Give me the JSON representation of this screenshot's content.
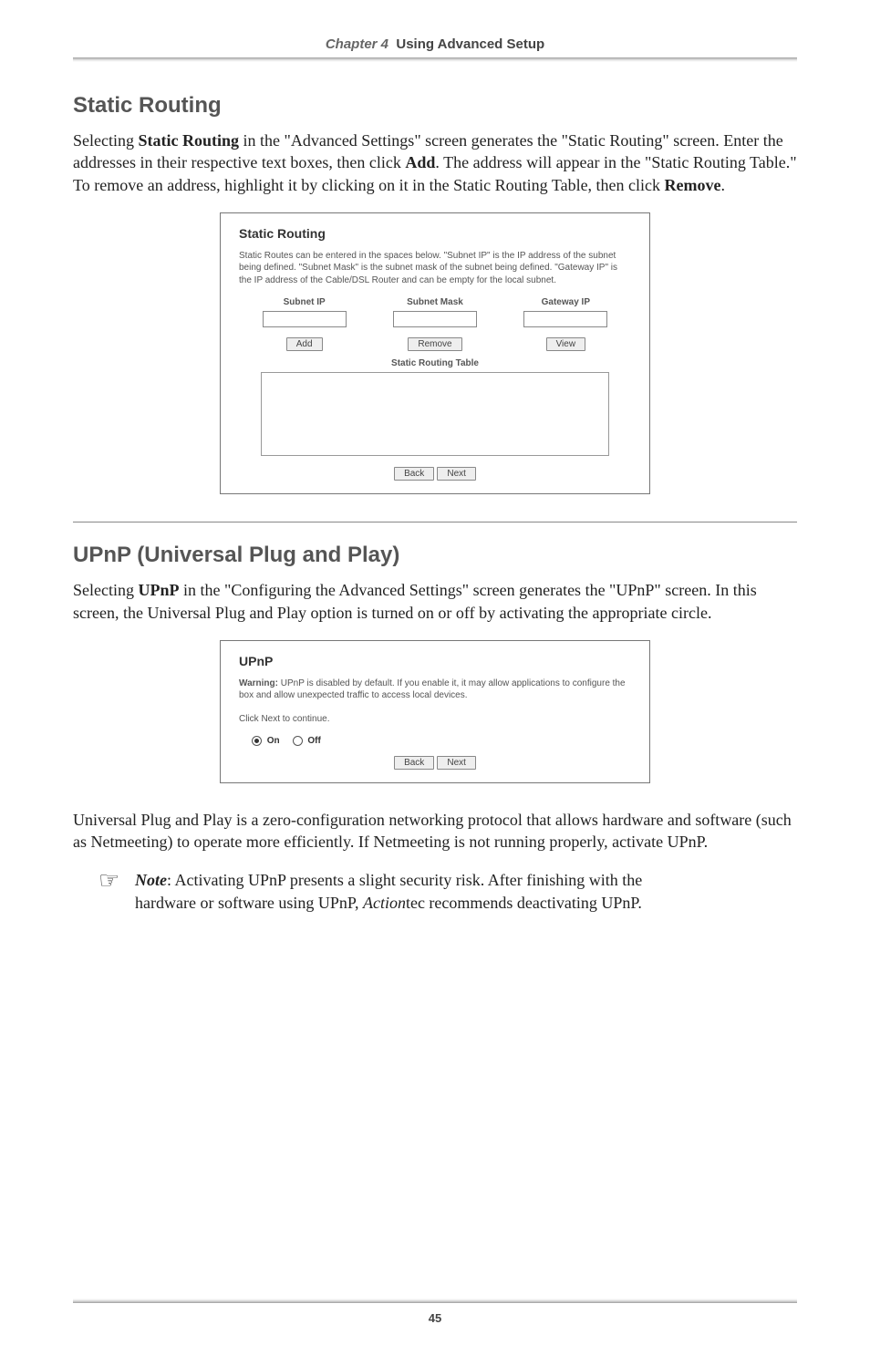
{
  "header": {
    "chapter": "Chapter 4",
    "title": "Using Advanced Setup"
  },
  "section1": {
    "heading": "Static Routing",
    "body_html": "Selecting <b>Static Routing</b> in the \"Advanced Settings\" screen generates the \"Static Routing\" screen. Enter the addresses in their respective text boxes, then click <b>Add</b>. The address will appear in the \"Static Routing Table.\" To remove an address, highlight it by clicking on it in the Static Routing Table, then click <b>Remove</b>."
  },
  "static_routing_panel": {
    "title": "Static Routing",
    "desc": "Static Routes can be entered in the spaces below. \"Subnet IP\" is the IP address of the subnet being defined. \"Subnet Mask\" is the subnet mask of the subnet being defined. \"Gateway IP\" is the IP address of the Cable/DSL Router and can be empty for the local subnet.",
    "cols": {
      "subnet_ip": "Subnet IP",
      "subnet_mask": "Subnet Mask",
      "gateway_ip": "Gateway IP"
    },
    "buttons": {
      "add": "Add",
      "remove": "Remove",
      "view": "View",
      "back": "Back",
      "next": "Next"
    },
    "table_caption": "Static Routing Table"
  },
  "section2": {
    "heading": "UPnP (Universal Plug and Play)",
    "body_html": "Selecting <b>UPnP</b> in the \"Configuring the Advanced Settings\" screen generates the \"UPnP\" screen. In this screen, the Universal Plug and Play option is turned on or off by activating the appropriate circle."
  },
  "upnp_panel": {
    "title": "UPnP",
    "warning_label": "Warning:",
    "warning_text": " UPnP is disabled by default. If you enable it, it may allow applications to configure the box and allow unexpected traffic to access local devices.",
    "continue_text": "Click Next to continue.",
    "on_label": "On",
    "off_label": "Off",
    "back": "Back",
    "next": "Next"
  },
  "para3": "Universal Plug and Play is a zero-configuration networking protocol that allows hardware and software (such as Netmeeting) to operate more efficiently. If Netmeeting is not running properly, activate UPnP.",
  "note": {
    "label": "Note",
    "rest1": ": Activating UPnP presents a slight security risk. After finishing with the hardware or software using UPnP, ",
    "action": "Action",
    "rest2": "tec recommends deactivating UPnP."
  },
  "page_number": "45"
}
